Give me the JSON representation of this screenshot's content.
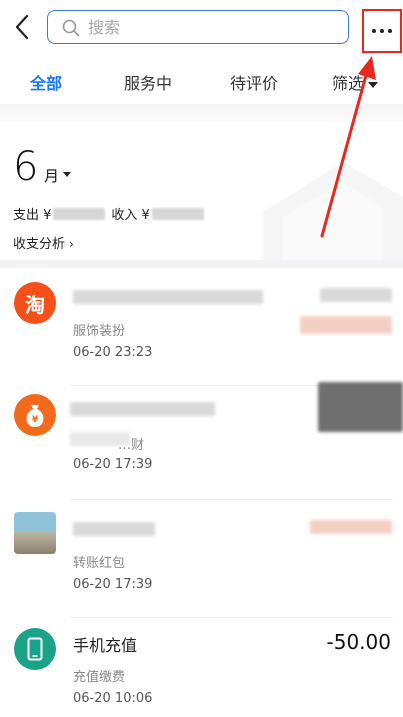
{
  "search": {
    "placeholder": "搜索"
  },
  "tabs": [
    {
      "label": "全部"
    },
    {
      "label": "服务中"
    },
    {
      "label": "待评价"
    },
    {
      "label": "筛选"
    }
  ],
  "summary": {
    "month": "6",
    "month_unit": "月",
    "expense_label": "支出 ¥",
    "income_label": "收入 ¥",
    "analysis_label": "收支分析",
    "analysis_chevron": "›"
  },
  "transactions": [
    {
      "icon": "taobao-icon",
      "icon_text": "淘",
      "icon_color": "#f5501a",
      "title": "",
      "subtitle": "服饰装扮",
      "date": "06-20",
      "time": "23:23",
      "amount": ""
    },
    {
      "icon": "money-bag-icon",
      "icon_text": "¥",
      "icon_color": "#f26b1d",
      "title": "",
      "subtitle": "…财",
      "date": "06-20",
      "time": "17:39",
      "amount": ""
    },
    {
      "icon": "user-avatar-icon",
      "icon_text": "",
      "icon_color": "#9bb7c6",
      "title": "",
      "subtitle": "转账红包",
      "date": "06-20",
      "time": "17:39",
      "amount": ""
    },
    {
      "icon": "phone-icon",
      "icon_text": "",
      "icon_color": "#1aa389",
      "title": "手机充值",
      "subtitle": "充值缴费",
      "date": "06-20",
      "time": "10:06",
      "amount": "-50.00"
    }
  ],
  "colors": {
    "accent": "#1677ff",
    "annotation_red": "#e8281e"
  }
}
